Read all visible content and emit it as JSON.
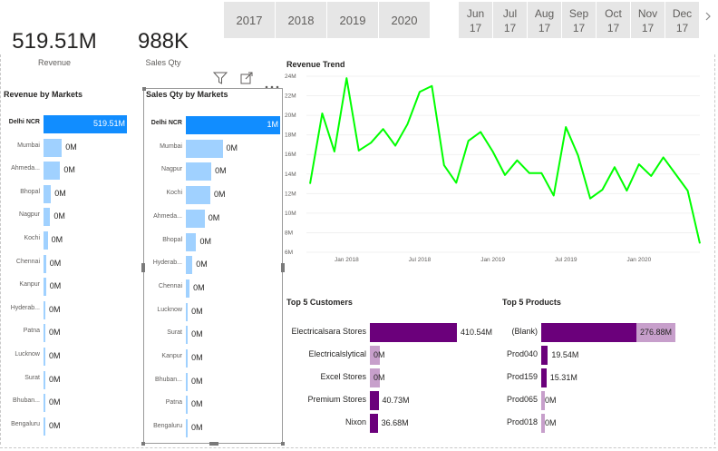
{
  "cards": [
    {
      "value": "519.51M",
      "label": "Revenue"
    },
    {
      "value": "988K",
      "label": "Sales Qty"
    }
  ],
  "years": [
    "2017",
    "2018",
    "2019",
    "2020"
  ],
  "months": [
    {
      "m": "Jun",
      "y": "17"
    },
    {
      "m": "Jul",
      "y": "17"
    },
    {
      "m": "Aug",
      "y": "17"
    },
    {
      "m": "Sep",
      "y": "17"
    },
    {
      "m": "Oct",
      "y": "17"
    },
    {
      "m": "Nov",
      "y": "17"
    },
    {
      "m": "Dec",
      "y": "17"
    }
  ],
  "scroll_icon": "chevron-right-icon",
  "toolbar_icons": [
    "filter-icon",
    "focus-mode-icon",
    "more-options-icon"
  ],
  "revenue_by_markets": {
    "title": "Revenue by Markets",
    "rows": [
      {
        "cat": "Delhi NCR",
        "val": "519.51M",
        "frac": 1.0,
        "selected": true
      },
      {
        "cat": "Mumbai",
        "val": "0M",
        "frac": 0.22
      },
      {
        "cat": "Ahmeda...",
        "val": "0M",
        "frac": 0.2
      },
      {
        "cat": "Bhopal",
        "val": "0M",
        "frac": 0.09
      },
      {
        "cat": "Nagpur",
        "val": "0M",
        "frac": 0.08
      },
      {
        "cat": "Kochi",
        "val": "0M",
        "frac": 0.05
      },
      {
        "cat": "Chennai",
        "val": "0M",
        "frac": 0.03
      },
      {
        "cat": "Kanpur",
        "val": "0M",
        "frac": 0.03
      },
      {
        "cat": "Hyderab...",
        "val": "0M",
        "frac": 0.02
      },
      {
        "cat": "Patna",
        "val": "0M",
        "frac": 0.02
      },
      {
        "cat": "Lucknow",
        "val": "0M",
        "frac": 0.02
      },
      {
        "cat": "Surat",
        "val": "0M",
        "frac": 0.02
      },
      {
        "cat": "Bhuban...",
        "val": "0M",
        "frac": 0.01
      },
      {
        "cat": "Bengaluru",
        "val": "0M",
        "frac": 0.01
      }
    ]
  },
  "sales_qty_by_markets": {
    "title": "Sales Qty by Markets",
    "rows": [
      {
        "cat": "Delhi NCR",
        "val": "1M",
        "frac": 1.0,
        "selected": true
      },
      {
        "cat": "Mumbai",
        "val": "0M",
        "frac": 0.39
      },
      {
        "cat": "Nagpur",
        "val": "0M",
        "frac": 0.27
      },
      {
        "cat": "Kochi",
        "val": "0M",
        "frac": 0.26
      },
      {
        "cat": "Ahmeda...",
        "val": "0M",
        "frac": 0.2
      },
      {
        "cat": "Bhopal",
        "val": "0M",
        "frac": 0.11
      },
      {
        "cat": "Hyderab...",
        "val": "0M",
        "frac": 0.07
      },
      {
        "cat": "Chennai",
        "val": "0M",
        "frac": 0.04
      },
      {
        "cat": "Lucknow",
        "val": "0M",
        "frac": 0.02
      },
      {
        "cat": "Surat",
        "val": "0M",
        "frac": 0.02
      },
      {
        "cat": "Kanpur",
        "val": "0M",
        "frac": 0.02
      },
      {
        "cat": "Bhuban...",
        "val": "0M",
        "frac": 0.01
      },
      {
        "cat": "Patna",
        "val": "0M",
        "frac": 0.01
      },
      {
        "cat": "Bengaluru",
        "val": "0M",
        "frac": 0.01
      }
    ]
  },
  "colors": {
    "selected_bar": "#118dff",
    "light_bar": "#a0d1ff",
    "trend_line": "#00ff00",
    "purple_dark": "#6b007b",
    "purple_light": "#c79fcb",
    "slicer_bg": "#e6e6e6"
  },
  "chart_data": [
    {
      "type": "line",
      "title": "Revenue Trend",
      "xlabel": "",
      "ylabel": "",
      "x_ticks": [
        "Jan 2018",
        "Jul 2018",
        "Jan 2019",
        "Jul 2019",
        "Jan 2020"
      ],
      "y_ticks": [
        "6M",
        "8M",
        "10M",
        "12M",
        "14M",
        "16M",
        "18M",
        "20M",
        "22M",
        "24M"
      ],
      "ylim": [
        6,
        24
      ],
      "y_unit": "M",
      "x": [
        "Oct 2017",
        "Nov 2017",
        "Dec 2017",
        "Jan 2018",
        "Feb 2018",
        "Mar 2018",
        "Apr 2018",
        "May 2018",
        "Jun 2018",
        "Jul 2018",
        "Aug 2018",
        "Sep 2018",
        "Oct 2018",
        "Nov 2018",
        "Dec 2018",
        "Jan 2019",
        "Feb 2019",
        "Mar 2019",
        "Apr 2019",
        "May 2019",
        "Jun 2019",
        "Jul 2019",
        "Aug 2019",
        "Sep 2019",
        "Oct 2019",
        "Nov 2019",
        "Dec 2019",
        "Jan 2020",
        "Feb 2020",
        "Mar 2020",
        "Apr 2020",
        "May 2020",
        "Jun 2020"
      ],
      "values": [
        13.0,
        20.2,
        16.3,
        23.8,
        16.4,
        17.2,
        18.6,
        16.9,
        19.1,
        22.4,
        23.0,
        14.9,
        13.1,
        17.4,
        18.3,
        16.3,
        13.9,
        15.4,
        14.1,
        14.1,
        11.8,
        18.8,
        15.9,
        11.5,
        12.4,
        14.7,
        12.3,
        15.0,
        13.8,
        15.7,
        14.0,
        12.3,
        6.9
      ],
      "grid": true,
      "legend": "none"
    },
    {
      "type": "bar",
      "orientation": "horizontal",
      "title": "Top 5 Customers",
      "categories": [
        "Electricalsara Stores",
        "Electricalslytical",
        "Excel Stores",
        "Premium Stores",
        "Nixon"
      ],
      "values": [
        410.54,
        0,
        0,
        40.73,
        36.68
      ],
      "labels": [
        "410.54M",
        "0M",
        "0M",
        "40.73M",
        "36.68M"
      ],
      "light_fraction": [
        0.0,
        0.11,
        0.11,
        0.0,
        0.0
      ],
      "unit": "M"
    },
    {
      "type": "bar",
      "orientation": "horizontal",
      "title": "Top 5 Products",
      "categories": [
        "(Blank)",
        "Prod040",
        "Prod159",
        "Prod065",
        "Prod018"
      ],
      "values": [
        276.88,
        19.54,
        15.31,
        0,
        0
      ],
      "labels": [
        "276.88M",
        "19.54M",
        "15.31M",
        "0M",
        "0M"
      ],
      "light_fraction": [
        0.41,
        0.0,
        0.0,
        0.04,
        0.04
      ],
      "unit": "M"
    }
  ]
}
